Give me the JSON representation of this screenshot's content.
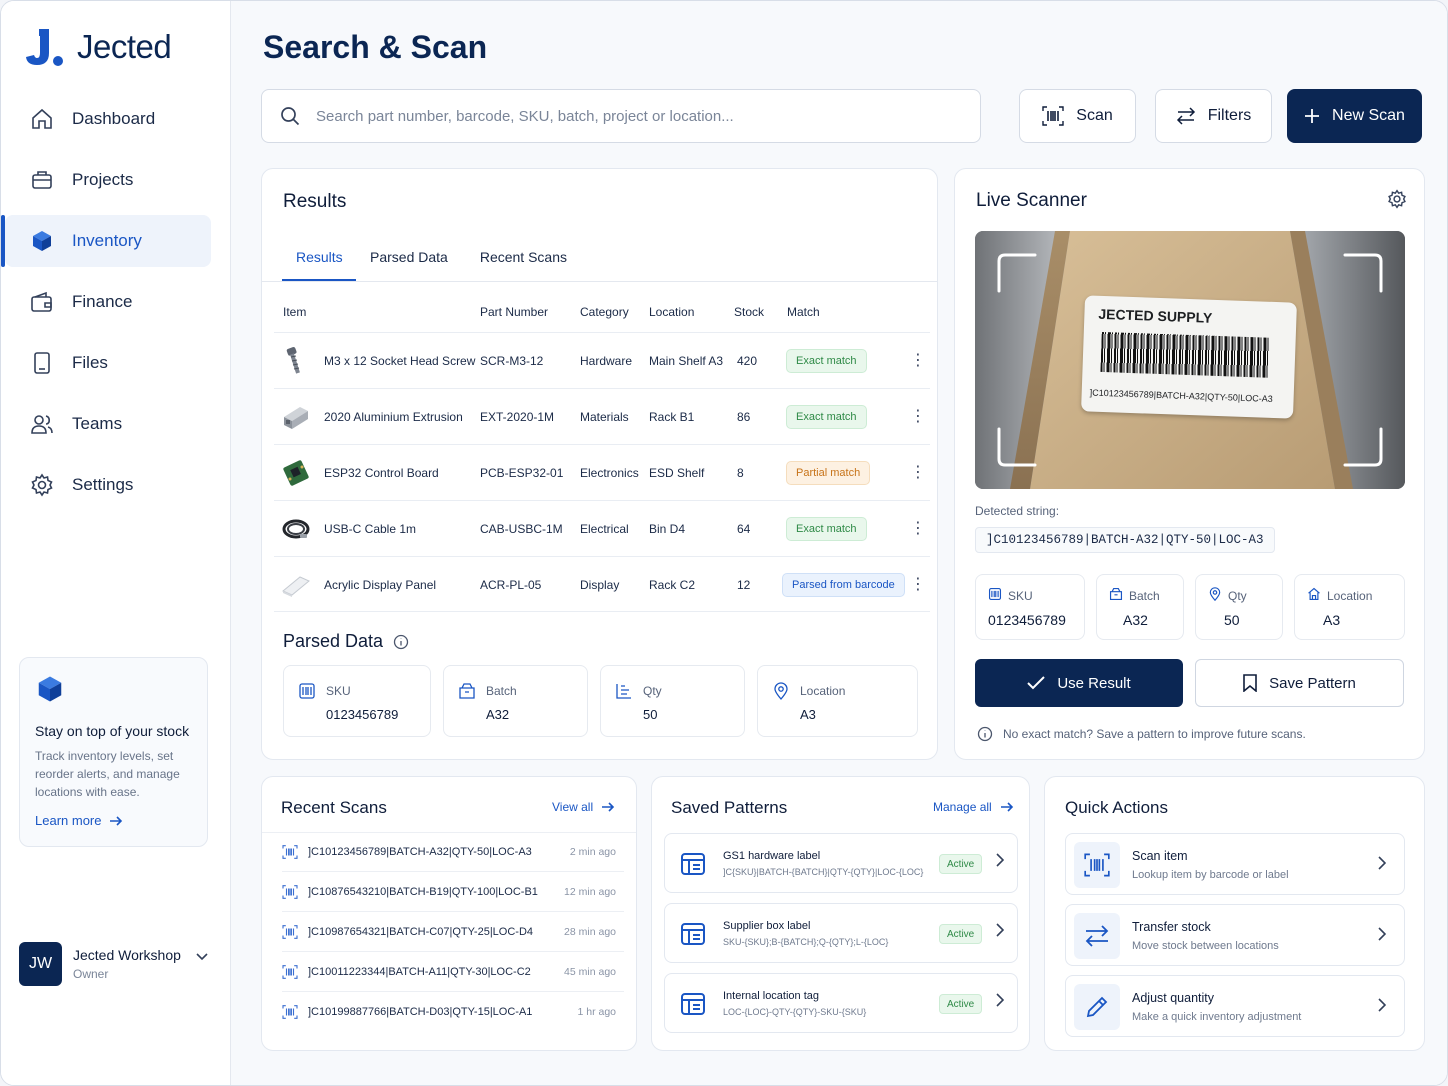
{
  "app": {
    "name": "Jected"
  },
  "sidebar": {
    "items": [
      {
        "label": "Dashboard",
        "icon": "home-icon"
      },
      {
        "label": "Projects",
        "icon": "briefcase-icon"
      },
      {
        "label": "Inventory",
        "icon": "cube-icon",
        "active": true
      },
      {
        "label": "Finance",
        "icon": "wallet-icon"
      },
      {
        "label": "Files",
        "icon": "file-icon"
      },
      {
        "label": "Teams",
        "icon": "users-icon"
      },
      {
        "label": "Settings",
        "icon": "gear-icon"
      }
    ],
    "promo": {
      "title": "Stay on top of your stock",
      "text": "Track inventory levels, set reorder alerts, and manage locations with ease.",
      "link": "Learn more"
    },
    "user": {
      "initials": "JW",
      "name": "Jected Workshop",
      "role": "Owner"
    }
  },
  "header": {
    "title": "Search & Scan",
    "search_placeholder": "Search part number, barcode, SKU, batch, project or location...",
    "scan_label": "Scan",
    "filters_label": "Filters",
    "new_scan_label": "New Scan"
  },
  "results": {
    "title": "Results",
    "tabs": [
      "Results",
      "Parsed Data",
      "Recent Scans"
    ],
    "columns": [
      "Item",
      "Part Number",
      "Category",
      "Location",
      "Stock",
      "Match"
    ],
    "rows": [
      {
        "item": "M3 x 12 Socket Head Screw",
        "part": "SCR-M3-12",
        "category": "Hardware",
        "location": "Main Shelf A3",
        "stock": "420",
        "match": "Exact match",
        "type": "green"
      },
      {
        "item": "2020 Aluminium Extrusion",
        "part": "EXT-2020-1M",
        "category": "Materials",
        "location": "Rack B1",
        "stock": "86",
        "match": "Exact match",
        "type": "green"
      },
      {
        "item": "ESP32 Control Board",
        "part": "PCB-ESP32-01",
        "category": "Electronics",
        "location": "ESD Shelf",
        "stock": "8",
        "match": "Partial match",
        "type": "orange"
      },
      {
        "item": "USB-C Cable 1m",
        "part": "CAB-USBC-1M",
        "category": "Electrical",
        "location": "Bin D4",
        "stock": "64",
        "match": "Exact match",
        "type": "green"
      },
      {
        "item": "Acrylic Display Panel",
        "part": "ACR-PL-05",
        "category": "Display",
        "location": "Rack C2",
        "stock": "12",
        "match": "Parsed from barcode",
        "type": "blue"
      }
    ],
    "parsed": {
      "title": "Parsed Data",
      "fields": [
        {
          "label": "SKU",
          "value": "0123456789"
        },
        {
          "label": "Batch",
          "value": "A32"
        },
        {
          "label": "Qty",
          "value": "50"
        },
        {
          "label": "Location",
          "value": "A3"
        }
      ]
    }
  },
  "scanner": {
    "title": "Live Scanner",
    "label_title": "JECTED SUPPLY",
    "label_code": "]C10123456789|BATCH-A32|QTY-50|LOC-A3",
    "detected_label": "Detected string:",
    "detected_value": "]C10123456789|BATCH-A32|QTY-50|LOC-A3",
    "fields": [
      {
        "label": "SKU",
        "value": "0123456789"
      },
      {
        "label": "Batch",
        "value": "A32"
      },
      {
        "label": "Qty",
        "value": "50"
      },
      {
        "label": "Location",
        "value": "A3"
      }
    ],
    "use_result": "Use Result",
    "save_pattern": "Save Pattern",
    "hint": "No exact match? Save a pattern to improve future scans."
  },
  "recent_scans": {
    "title": "Recent Scans",
    "view_all": "View all",
    "items": [
      {
        "code": "]C10123456789|BATCH-A32|QTY-50|LOC-A3",
        "time": "2 min ago"
      },
      {
        "code": "]C10876543210|BATCH-B19|QTY-100|LOC-B1",
        "time": "12 min ago"
      },
      {
        "code": "]C10987654321|BATCH-C07|QTY-25|LOC-D4",
        "time": "28 min ago"
      },
      {
        "code": "]C10011223344|BATCH-A11|QTY-30|LOC-C2",
        "time": "45 min ago"
      },
      {
        "code": "]C10199887766|BATCH-D03|QTY-15|LOC-A1",
        "time": "1 hr ago"
      }
    ]
  },
  "saved_patterns": {
    "title": "Saved Patterns",
    "manage_all": "Manage all",
    "items": [
      {
        "name": "GS1 hardware label",
        "format": "]C{SKU}|BATCH-{BATCH}|QTY-{QTY}|LOC-{LOC}",
        "status": "Active"
      },
      {
        "name": "Supplier box label",
        "format": "SKU-{SKU};B-{BATCH};Q-{QTY};L-{LOC}",
        "status": "Active"
      },
      {
        "name": "Internal location tag",
        "format": "LOC-{LOC}-QTY-{QTY}-SKU-{SKU}",
        "status": "Active"
      }
    ]
  },
  "quick_actions": {
    "title": "Quick Actions",
    "items": [
      {
        "name": "Scan item",
        "desc": "Lookup item by barcode or label",
        "icon": "barcode-icon"
      },
      {
        "name": "Transfer stock",
        "desc": "Move stock between locations",
        "icon": "transfer-icon"
      },
      {
        "name": "Adjust quantity",
        "desc": "Make a quick inventory adjustment",
        "icon": "pencil-icon"
      }
    ]
  },
  "colors": {
    "brand": "#0b2653",
    "accent": "#1a56c4",
    "success": "#2f8a47",
    "warning": "#c7741a"
  }
}
